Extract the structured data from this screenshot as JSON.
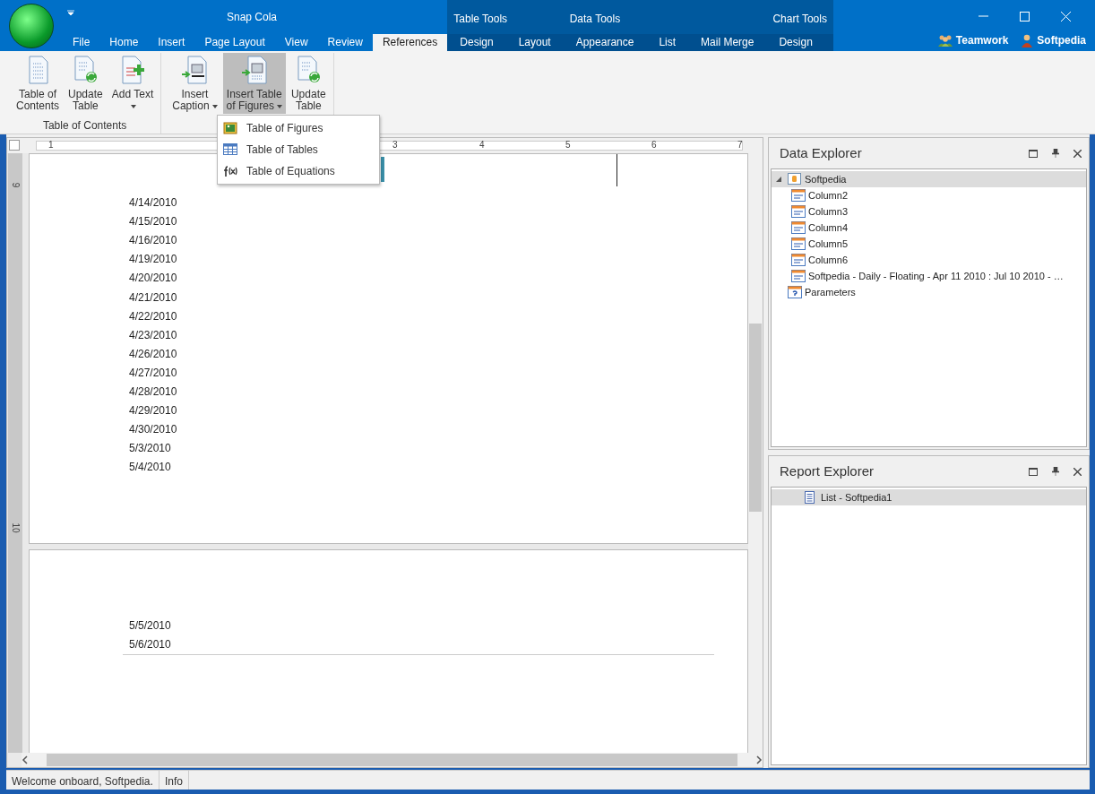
{
  "window": {
    "title": "Snap Cola"
  },
  "tabs": [
    {
      "label": "File",
      "selected": false
    },
    {
      "label": "Home",
      "selected": false
    },
    {
      "label": "Insert",
      "selected": false
    },
    {
      "label": "Page Layout",
      "selected": false
    },
    {
      "label": "View",
      "selected": false
    },
    {
      "label": "Review",
      "selected": false
    },
    {
      "label": "References",
      "selected": true
    }
  ],
  "context_groups": [
    {
      "label": "Table Tools",
      "tabs": [
        {
          "label": "Design",
          "selected": false
        },
        {
          "label": "Layout",
          "selected": false
        }
      ]
    },
    {
      "label": "Data Tools",
      "tabs": [
        {
          "label": "Appearance",
          "selected": false
        },
        {
          "label": "List",
          "selected": false
        },
        {
          "label": "Mail Merge",
          "selected": false
        }
      ]
    },
    {
      "label": "Chart Tools",
      "tabs": [
        {
          "label": "Design",
          "selected": false
        }
      ]
    }
  ],
  "users": [
    {
      "label": "Teamwork",
      "kind": "team"
    },
    {
      "label": "Softpedia",
      "kind": "user"
    }
  ],
  "ribbon": {
    "groups": [
      {
        "label": "Table of Contents",
        "buttons": [
          {
            "lines": [
              "Table of",
              "Contents"
            ],
            "kind": "toc",
            "dropdown": false,
            "pressed": false
          },
          {
            "lines": [
              "Update",
              "Table"
            ],
            "kind": "update",
            "dropdown": false,
            "pressed": false
          },
          {
            "lines": [
              "Add Text"
            ],
            "kind": "addtext",
            "dropdown": true,
            "pressed": false
          }
        ]
      },
      {
        "buttons": [
          {
            "lines": [
              "Insert",
              "Caption"
            ],
            "kind": "caption",
            "dropdown": true,
            "pressed": false
          },
          {
            "lines": [
              "Insert Table",
              "of Figures"
            ],
            "kind": "figures",
            "dropdown": true,
            "pressed": true
          },
          {
            "lines": [
              "Update",
              "Table"
            ],
            "kind": "update",
            "dropdown": false,
            "pressed": false
          }
        ]
      }
    ]
  },
  "menu": {
    "items": [
      {
        "label": "Table of Figures",
        "kind": "picture"
      },
      {
        "label": "Table of Tables",
        "kind": "table"
      },
      {
        "label": "Table of Equations",
        "kind": "equation"
      }
    ]
  },
  "ruler": {
    "labels": [
      "1",
      "3",
      "4",
      "5",
      "6",
      "7"
    ]
  },
  "vertical_ruler": {
    "labels": [
      "9",
      "10"
    ]
  },
  "pages": [
    {
      "lines": [
        "4/14/2010",
        "4/15/2010",
        "4/16/2010",
        "4/19/2010",
        "4/20/2010",
        "4/21/2010",
        "4/22/2010",
        "4/23/2010",
        "4/26/2010",
        "4/27/2010",
        "4/28/2010",
        "4/29/2010",
        "4/30/2010",
        "5/3/2010",
        "5/4/2010"
      ]
    },
    {
      "lines": [
        "5/5/2010",
        "5/6/2010"
      ]
    }
  ],
  "data_explorer": {
    "title": "Data Explorer",
    "tree": [
      {
        "label": "Softpedia",
        "kind": "source",
        "expanded": true,
        "selected": true,
        "children": [
          {
            "label": "Column2",
            "kind": "field",
            "selected": false
          },
          {
            "label": "Column3",
            "kind": "field",
            "selected": false
          },
          {
            "label": "Column4",
            "kind": "field",
            "selected": false
          },
          {
            "label": "Column5",
            "kind": "field",
            "selected": false
          },
          {
            "label": "Column6",
            "kind": "field",
            "selected": false
          },
          {
            "label": "Softpedia - Daily - Floating - Apr 11 2010 : Jul 10 2010 - …",
            "kind": "field",
            "selected": false
          }
        ]
      },
      {
        "label": "Parameters",
        "kind": "params",
        "selected": false
      }
    ]
  },
  "report_explorer": {
    "title": "Report Explorer",
    "tree": [
      {
        "label": "List - Softpedia1",
        "kind": "report",
        "selected": true
      }
    ]
  },
  "status_bar": [
    "Welcome onboard, Softpedia.",
    "Info"
  ]
}
